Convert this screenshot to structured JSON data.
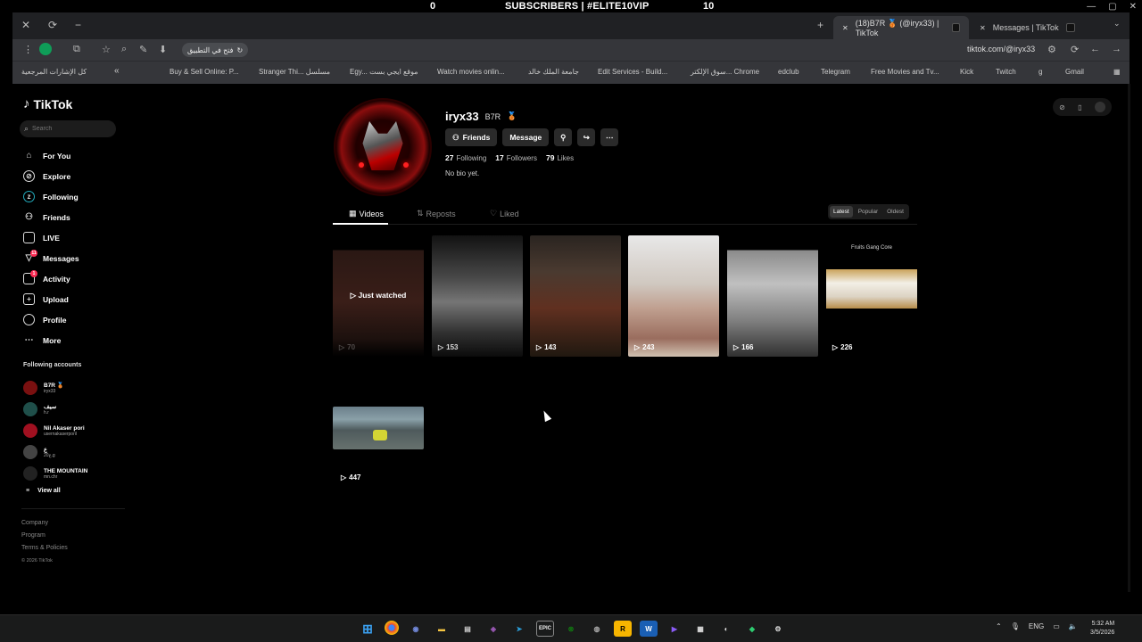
{
  "overlay": {
    "left_count": "0",
    "title": "SUBSCRIBERS | #ELITE10VIP",
    "right_count": "10"
  },
  "browser": {
    "tabs": [
      {
        "label": "(18)B7R 🥉 (@iryx33) | TikTok",
        "active": true
      },
      {
        "label": "Messages | TikTok",
        "active": false
      }
    ],
    "url": "tiktok.com/@iryx33",
    "open_in_app": "فتح في التطبيق",
    "bookmarks": [
      "كل الإشارات المرجعية",
      "Buy & Sell Online: P...",
      "Stranger Thi... مسلسل",
      "Egy... موقع ايجي بست",
      "Watch movies onlin...",
      "جامعة الملك خالد",
      "Edit Services - Build...",
      "سوق الإلكتر... Chrome",
      "edclub",
      "Telegram",
      "Free Movies and Tv...",
      "Kick",
      "Twitch",
      "g",
      "Gmail"
    ]
  },
  "sidebar": {
    "logo": "TikTok",
    "search_placeholder": "Search",
    "nav": [
      {
        "label": "For You",
        "icon": "home-icon"
      },
      {
        "label": "Explore",
        "icon": "compass-icon"
      },
      {
        "label": "Following",
        "icon": "following-icon"
      },
      {
        "label": "Friends",
        "icon": "friends-icon"
      },
      {
        "label": "LIVE",
        "icon": "live-icon"
      },
      {
        "label": "Messages",
        "icon": "messages-icon",
        "badge": "11"
      },
      {
        "label": "Activity",
        "icon": "activity-icon",
        "badge": "1"
      },
      {
        "label": "Upload",
        "icon": "upload-icon"
      },
      {
        "label": "Profile",
        "icon": "profile-icon"
      },
      {
        "label": "More",
        "icon": "more-icon"
      }
    ],
    "following_label": "Following accounts",
    "accounts": [
      {
        "name": "B7R 🥉",
        "handle": "iryx33"
      },
      {
        "name": "سيف",
        "handle": "h.r"
      },
      {
        "name": "Nil Akaser pori",
        "handle": "usernakaserporil"
      },
      {
        "name": "ع",
        "handle": "ع20.g"
      },
      {
        "name": "THE MOUNTAIN",
        "handle": "mn.chr"
      }
    ],
    "view_all": "View all",
    "footer": [
      "Company",
      "Program",
      "Terms & Policies"
    ],
    "copyright": "© 2026 TikTok"
  },
  "profile": {
    "username": "iryx33",
    "nickname": "B7R",
    "following_count": "27",
    "following_label": "Following",
    "followers_count": "17",
    "followers_label": "Followers",
    "likes_count": "79",
    "likes_label": "Likes",
    "bio": "No bio yet.",
    "friends_button": "Friends",
    "message_button": "Message"
  },
  "tabs": {
    "videos": "Videos",
    "reposts": "Reposts",
    "liked": "Liked"
  },
  "sort": {
    "latest": "Latest",
    "popular": "Popular",
    "oldest": "Oldest"
  },
  "videos": [
    {
      "views": "70",
      "overlay": "Just watched"
    },
    {
      "views": "153"
    },
    {
      "views": "143"
    },
    {
      "views": "243"
    },
    {
      "views": "166"
    },
    {
      "views": "226",
      "caption": "Fruits Gang Core"
    },
    {
      "views": "447"
    }
  ],
  "taskbar": {
    "lang": "ENG",
    "time": "5:32 AM",
    "date": "3/5/2026"
  }
}
